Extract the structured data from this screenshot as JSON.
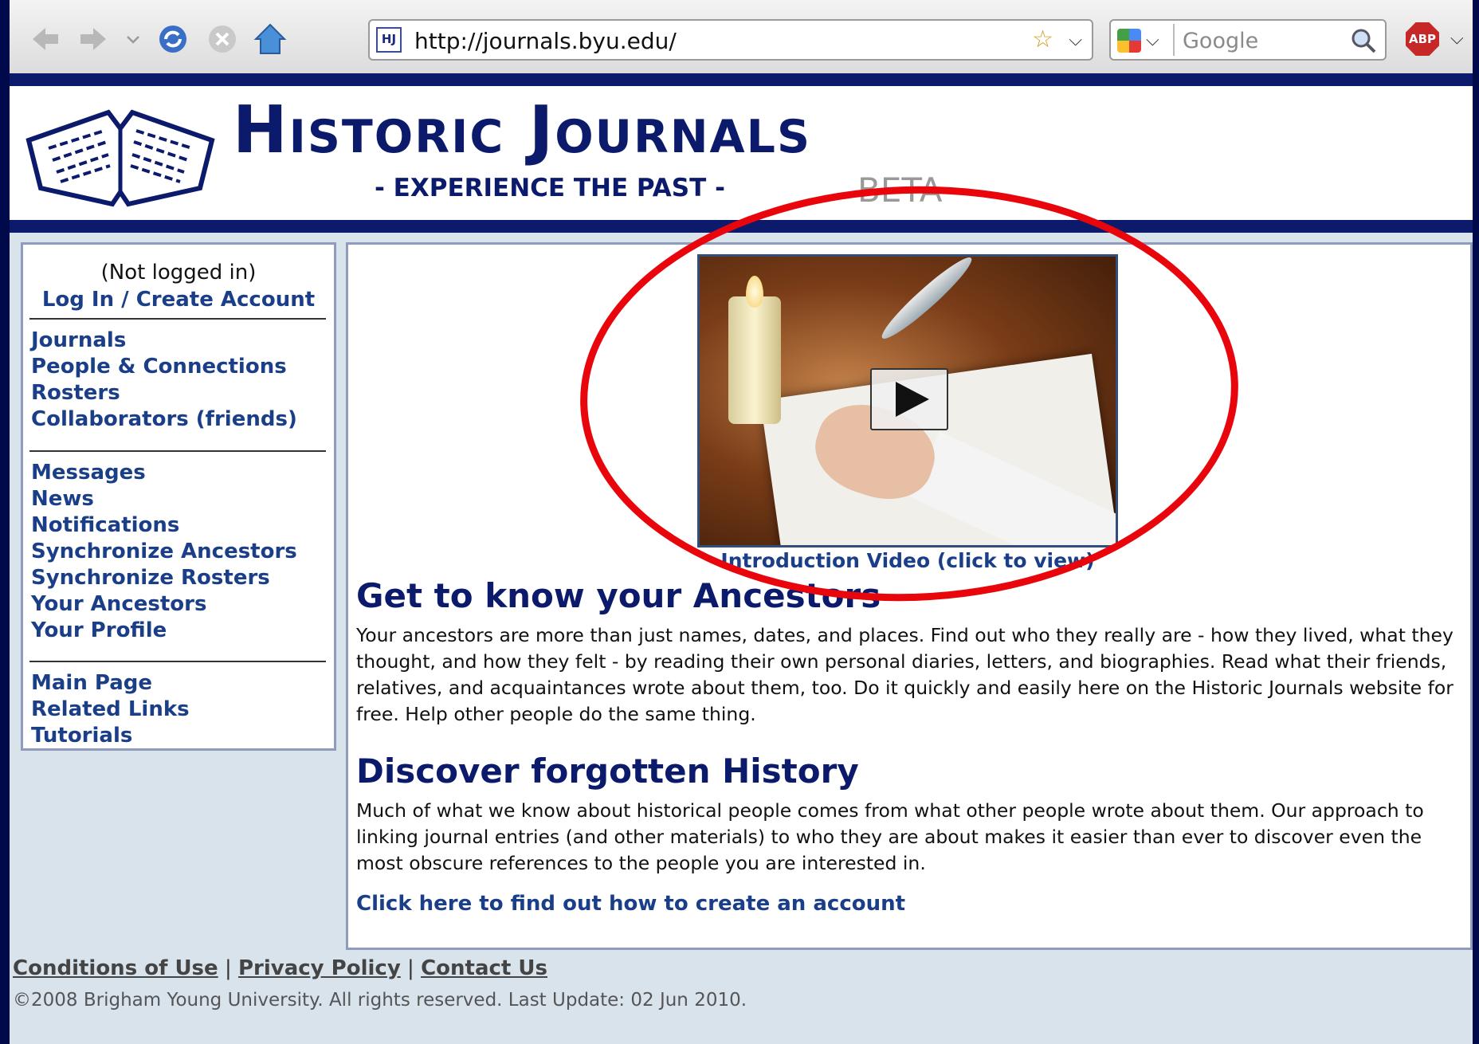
{
  "browser": {
    "url": "http://journals.byu.edu/",
    "favicon_text": "HJ",
    "search_placeholder": "Google",
    "adblock_label": "ABP"
  },
  "header": {
    "title": "Historic Journals",
    "tagline": "- EXPERIENCE THE PAST -",
    "beta": "BETA"
  },
  "sidebar": {
    "status": "(Not logged in)",
    "login_link": "Log In / Create Account",
    "group1": [
      "Journals",
      "People & Connections",
      "Rosters",
      "Collaborators (friends)"
    ],
    "group2": [
      "Messages",
      "News",
      "Notifications",
      "Synchronize Ancestors",
      "Synchronize Rosters",
      "Your Ancestors",
      "Your Profile"
    ],
    "group3": [
      "Main Page",
      "Related Links",
      "Tutorials"
    ]
  },
  "main": {
    "video_caption": "Introduction Video (click to view)",
    "section1_title": "Get to know your Ancestors",
    "section1_text": "Your ancestors are more than just names, dates, and places. Find out who they really are - how they lived, what they thought, and how they felt - by reading their own personal diaries, letters, and biographies. Read what their friends, relatives, and acquaintances wrote about them, too. Do it quickly and easily here on the Historic Journals website for free. Help other people do the same thing.",
    "section2_title": "Discover forgotten History",
    "section2_text": "Much of what we know about historical people comes from what other people wrote about them. Our approach to linking journal entries (and other materials) to who they are about makes it easier than ever to discover even the most obscure references to the people you are interested in.",
    "cta": "Click here to find out how to create an account"
  },
  "footer": {
    "links": [
      "Conditions of Use",
      "Privacy Policy",
      "Contact Us"
    ],
    "separator": "|",
    "copyright": "©2008 Brigham Young University. All rights reserved. Last Update: 02 Jun 2010."
  },
  "colors": {
    "navy": "#0b1a6b",
    "link": "#1a3e88",
    "annotation": "#e8060c"
  }
}
